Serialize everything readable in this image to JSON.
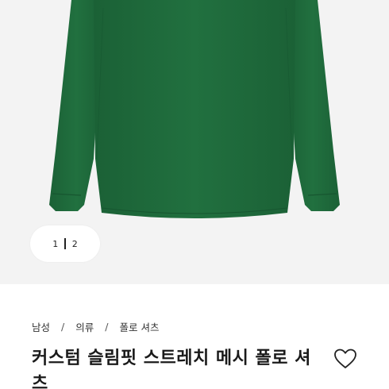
{
  "colors": {
    "garment": "#1f6b3c",
    "garment_shadow": "#175630",
    "background": "#f3f3f3"
  },
  "gallery": {
    "pager": {
      "current": "1",
      "total": "2"
    }
  },
  "breadcrumb": {
    "items": [
      "남성",
      "의류",
      "폴로 셔츠"
    ],
    "separator": "/"
  },
  "product": {
    "title": "커스텀 슬림핏 스트레치 메시 폴로 셔츠"
  },
  "icons": {
    "wishlist": "heart-outline-icon"
  }
}
